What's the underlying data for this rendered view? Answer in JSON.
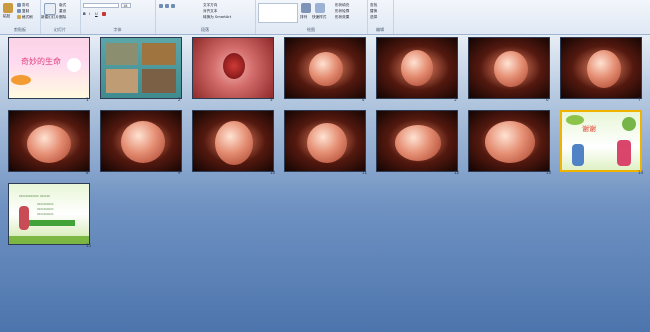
{
  "ribbon": {
    "groups": [
      {
        "label": "剪贴板"
      },
      {
        "label": "幻灯片"
      },
      {
        "label": "字体"
      },
      {
        "label": "段落"
      },
      {
        "label": "绘图"
      },
      {
        "label": "编辑"
      }
    ],
    "clipboard": {
      "paste": "粘贴",
      "cut": "剪切",
      "copy": "复制",
      "format": "格式刷"
    },
    "slides": {
      "new_slide": "新建幻灯片",
      "layout": "版式",
      "reset": "重设",
      "delete": "删除"
    },
    "font": {
      "name": "",
      "size": "18"
    },
    "drawing": {
      "arrange": "排列",
      "quick_styles": "快速样式",
      "shape_fill": "形状填充",
      "shape_outline": "形状轮廓",
      "shape_effects": "形状效果"
    },
    "paragraph": {
      "text_direction": "文字方向",
      "align_text": "对齐文本",
      "smartart": "转换为 SmartArt"
    },
    "editing": {
      "find": "查找",
      "replace": "替换",
      "select": "选择"
    }
  },
  "slides": [
    {
      "num": "1",
      "title": "奇妙的生命"
    },
    {
      "num": "2"
    },
    {
      "num": "3"
    },
    {
      "num": "4"
    },
    {
      "num": "5"
    },
    {
      "num": "6"
    },
    {
      "num": "7"
    },
    {
      "num": "8"
    },
    {
      "num": "9"
    },
    {
      "num": "10"
    },
    {
      "num": "11"
    },
    {
      "num": "12"
    },
    {
      "num": "13"
    },
    {
      "num": "14",
      "title": "谢谢"
    },
    {
      "num": "15"
    }
  ]
}
